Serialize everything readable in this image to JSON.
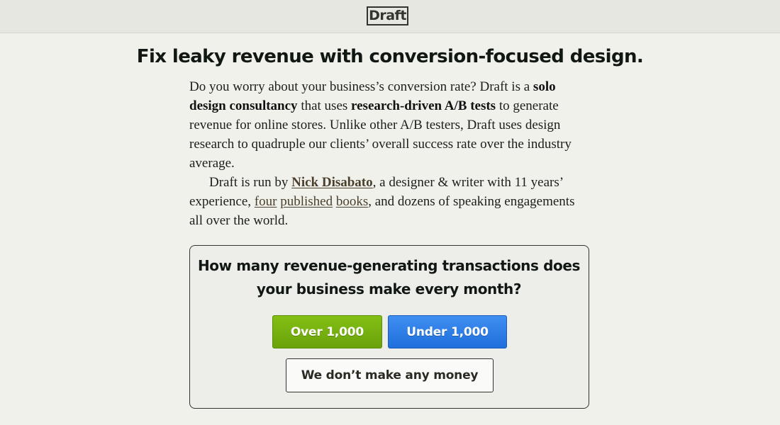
{
  "header": {
    "logo_text": "Draft"
  },
  "hero": {
    "headline": "Fix leaky revenue with conversion-focused design."
  },
  "intro": {
    "p1": {
      "t1": "Do you worry about your business’s conversion rate? Draft is a ",
      "b1": "solo design consultancy",
      "t2": " that uses ",
      "b2": "research-driven A/B tests",
      "t3": " to generate revenue for online stores. Unlike other A/B testers, Draft uses design research to quadruple our clients’ overall success rate over the industry average."
    },
    "p2": {
      "t1": "Draft is run by ",
      "author_link": "Nick Disabato",
      "t2": ", a designer & writer with 11 years’ experience, ",
      "link1": "four",
      "link2": "published",
      "link3": "books",
      "t3": ", and dozens of speaking engagements all over the world."
    }
  },
  "quiz": {
    "question": "How many revenue-generating transactions does your business make every month?",
    "over_label": "Over 1,000",
    "under_label": "Under 1,000",
    "none_label": "We don’t make any money"
  },
  "colors": {
    "background": "#f1f1ec",
    "header_bg": "#e7e7e1",
    "green_button": "#74ad0e",
    "blue_button": "#2a7de6",
    "text_dark": "#111814",
    "link": "#4a3f2c"
  }
}
